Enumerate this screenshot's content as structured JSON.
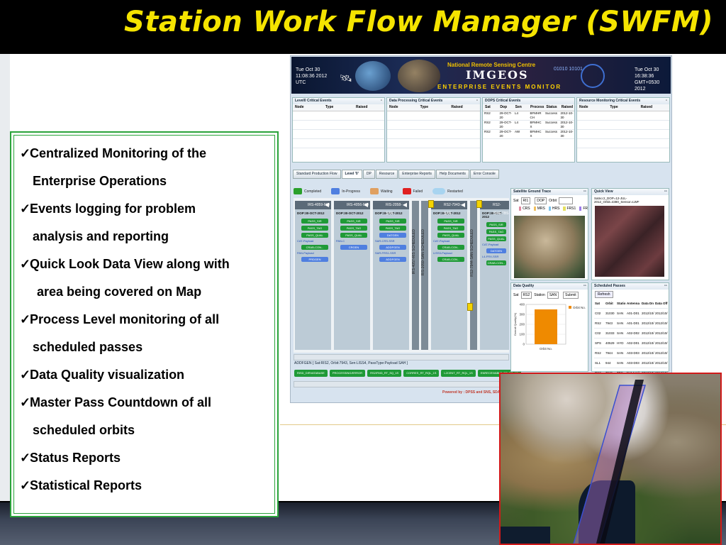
{
  "slide": {
    "title": "Station Work Flow Manager (SWFM)",
    "features": [
      {
        "line1": "Centralized Monitoring of the",
        "line2": "Enterprise Operations"
      },
      {
        "line1": "Events logging for problem",
        "line2": "analysis and reporting"
      },
      {
        "line1": "Quick Look Data View along with",
        "line2": "area being covered on Map"
      },
      {
        "line1": "Process Level monitoring of all",
        "line2": "scheduled passes"
      },
      {
        "line1": "Data Quality visualization",
        "line2": ""
      },
      {
        "line1": "Master Pass Countdown of all",
        "line2": "scheduled orbits"
      },
      {
        "line1": "Status Reports",
        "line2": ""
      },
      {
        "line1": "Statistical Reports",
        "line2": ""
      }
    ],
    "check_glyph": "✓"
  },
  "dashboard": {
    "banner": {
      "left_time": "Tue Oct 30 11:08:36 2012 UTC",
      "right_time": "Tue Oct 30 16:38:36 GMT+0530 2012",
      "org": "National Remote Sensing Centre",
      "app": "IMGEOS",
      "subtitle": "ENTERPRISE EVENTS MONITOR",
      "binary": "01010 10101"
    },
    "event_panels": [
      {
        "title": "Level0 Critical Events",
        "columns": [
          "Node",
          "Type",
          "Raised"
        ],
        "rows": []
      },
      {
        "title": "Data Processing Critical Events",
        "columns": [
          "Node",
          "Type",
          "Raised"
        ],
        "rows": []
      },
      {
        "title": "DOPS Critical Events",
        "columns": [
          "Sat",
          "Dop",
          "Sen",
          "Process",
          "Status",
          "Raised"
        ],
        "rows": [
          [
            "RS2",
            "29-OCT-20",
            "L4",
            "BFMHR CH",
            "Success",
            "2012-10-30 00:38:1"
          ],
          [
            "RS2",
            "29-OCT-20",
            "L4",
            "BFMHC X",
            "Success",
            "2012-10-30 00:39:3"
          ],
          [
            "RS2",
            "29-OCT-20",
            "AW",
            "BFMHC X",
            "Success",
            "2012-10-30 01:38:5"
          ]
        ]
      },
      {
        "title": "Resource Monitoring Critical Events",
        "columns": [
          "Node",
          "Type",
          "Raised"
        ],
        "rows": []
      }
    ],
    "tabs": [
      "Standard Production Flow",
      "Level '0'",
      "DP",
      "Resource",
      "Enterprise Reports",
      "Help Documents",
      "Error Console"
    ],
    "legend": [
      {
        "label": "Completed",
        "color": "#2aa02b"
      },
      {
        "label": "In-Progress",
        "color": "#4f7fe0"
      },
      {
        "label": "Waiting",
        "color": "#e0a060"
      },
      {
        "label": "Failed",
        "color": "#e02020"
      },
      {
        "label": "Restarted",
        "color": "#a8d4f0"
      }
    ],
    "pipelines": [
      {
        "header": "IRS-4059-IYD",
        "date": "DOP:30-OCT-2012",
        "steps": [
          "PASS_SIR",
          "PASS_TAG",
          "PASS_QUAL"
        ],
        "label1": "CAT-Payload",
        "step4": "CRAB-CON...",
        "label2": "PAN-Payload",
        "step5": "PRDGEN"
      },
      {
        "header": "IRS-4056-IYD",
        "date": "DOP:30-OCT-2012",
        "steps": [
          "PASS_SIR",
          "PASS_TAG",
          "PASS_QUAL"
        ],
        "label1": "PAN-C",
        "step4": "CRGEN",
        "label2": "",
        "step5": ""
      },
      {
        "header": "RIS-2058-SAN",
        "date": "DOP:30-OCT-2012",
        "steps": [
          "PASS_SIR",
          "PASS_TAG",
          "DATGEN"
        ],
        "label1": "SAR-CRS-SSR",
        "step4": "ADDFGEN",
        "label2": "SAR-FRS1-SSR",
        "step5": "ADDFGEN"
      },
      {
        "header": "RS2-7943-SAN",
        "date": "DOP:30-OCT-2012",
        "steps": [
          "PASS_SIR",
          "PASS_TAG",
          "PASS_QUAL"
        ],
        "label1": "CAT-Payload",
        "step4": "CRAB-CON...",
        "label2": "LISS3-Payload",
        "step5": "CRAB-CON..."
      },
      {
        "header": "RS2-7946-TBS",
        "date": "DOP:30-OCT-2012",
        "steps": [
          "PASS_SIR",
          "PASS_TAG",
          "PASS_QUAL"
        ],
        "label1": "CAT-Payload",
        "step4": "DATGEN",
        "label2": "L4-FRX-SSR",
        "step5": "CRAB-CON..."
      }
    ],
    "vbars": [
      "IRS-4057-RIS SCHEDULED",
      "RIS-2059-SAN SCHEDULED",
      "RS2-7944-SAN SCHEDULED"
    ],
    "info_line": "ADDFGEN [ Sat:RIS2, Orbit:7943, Sen:LISS4, PassType:Payload SAH ]",
    "process_buttons": [
      "RISD_DIRVATABASE",
      "PROCESSING/ERROR",
      "RS2/FMD_RT_SQ_1S",
      "CORRES_RT_RQL_1S",
      "L2CENT_RT_RQL_1S",
      "ENRECEIVABLE_RT_SQ_1S"
    ],
    "powered_by": "Powered by : DPSS and SNS, SDAPSA, NRSC",
    "ground_trace": {
      "title": "Satellite Ground Trace",
      "sat_label": "Sat",
      "sat_value": "RI1",
      "dop_value": "DOP",
      "orbit_label": "Orbit",
      "sensors": [
        "CRS",
        "MRS",
        "HRS",
        "FRS1",
        "FR"
      ]
    },
    "quick_view": {
      "title": "Quick View",
      "caption": "Satno:2_DOP=12-JUL-2012_Orbit=4380_Sensor=LWF"
    },
    "data_quality": {
      "title": "Data Quality",
      "sat_label": "Sat",
      "sat_value": "RS2",
      "station_label": "Station",
      "station_value": "SAN",
      "submit": "Submit",
      "legend": "Orbit No.",
      "xlabel": "Orbit No.",
      "ylabel": "Overall Quality(%)",
      "chart_data": {
        "type": "bar",
        "categories": [
          "Orbit No."
        ],
        "values": [
          350
        ],
        "ylim": [
          0,
          400
        ],
        "yticks": [
          400,
          300,
          200,
          100,
          0
        ]
      }
    },
    "scheduled_passes": {
      "title": "Scheduled Passes",
      "refresh": "Refresh",
      "columns": [
        "Sat",
        "Orbit",
        "Statio",
        "Antenna",
        "Data Dn",
        "Data Off"
      ],
      "rows": [
        [
          "C02",
          "31030",
          "SAN",
          "A01-D01",
          "2012/10/",
          "2012/10/"
        ],
        [
          "RS2",
          "7943",
          "SAN",
          "A01-D01",
          "2012/10/",
          "2012/10/"
        ],
        [
          "C02",
          "31033",
          "SAN",
          "A02-D02",
          "2012/10/",
          "2012/10/"
        ],
        [
          "SPS",
          "40529",
          "HYD",
          "A02-D01",
          "2012/10/",
          "2012/10/"
        ],
        [
          "RS2",
          "7944",
          "SAN",
          "A03-D03",
          "2012/10/",
          "2012/10/"
        ],
        [
          "SL1",
          "944",
          "SAN",
          "A03-D03",
          "2012/10/",
          "2012/10/"
        ],
        [
          "RS2",
          "7946",
          "TBS",
          "Not Avail",
          "2012/10/",
          "2012/10/"
        ]
      ]
    }
  },
  "colors": {
    "title_yellow": "#f5e400",
    "frame_green": "#2aa33a",
    "map_border": "#d01a1a",
    "pill_green": "#1f9a37",
    "pill_blue": "#4f7fe0"
  }
}
